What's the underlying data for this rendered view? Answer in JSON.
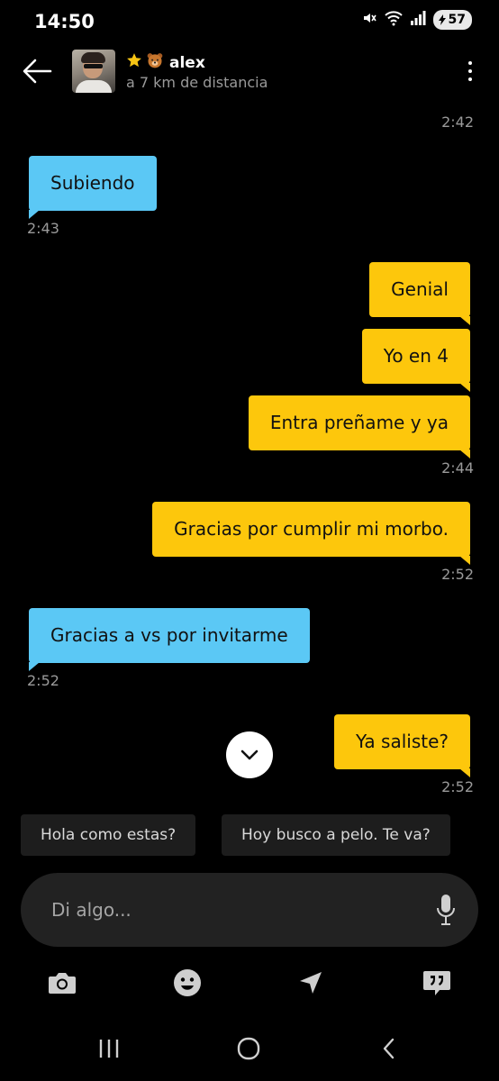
{
  "status_bar": {
    "time": "14:50",
    "battery": "57",
    "icons": [
      "mute-icon",
      "wifi-icon",
      "signal-icon",
      "battery-icon"
    ]
  },
  "header": {
    "badges": [
      "star-icon",
      "bear-icon"
    ],
    "name": "alex",
    "distance": "a 7 km de distancia"
  },
  "messages": [
    {
      "kind": "timestamp",
      "side": "right",
      "text": "2:42"
    },
    {
      "kind": "bubble",
      "direction": "in",
      "text": "Subiendo"
    },
    {
      "kind": "timestamp",
      "side": "left",
      "text": "2:43"
    },
    {
      "kind": "bubble",
      "direction": "out",
      "text": "Genial"
    },
    {
      "kind": "bubble",
      "direction": "out",
      "text": "Yo en 4"
    },
    {
      "kind": "bubble",
      "direction": "out",
      "text": "Entra preñame y ya"
    },
    {
      "kind": "timestamp",
      "side": "right",
      "text": "2:44"
    },
    {
      "kind": "bubble",
      "direction": "out",
      "text": "Gracias por cumplir mi morbo."
    },
    {
      "kind": "timestamp",
      "side": "right",
      "text": "2:52"
    },
    {
      "kind": "bubble",
      "direction": "in",
      "text": "Gracias a vs por invitarme"
    },
    {
      "kind": "timestamp",
      "side": "left",
      "text": "2:52"
    },
    {
      "kind": "bubble",
      "direction": "out",
      "text": "Ya saliste?"
    },
    {
      "kind": "timestamp",
      "side": "right",
      "text": "2:52"
    }
  ],
  "quick_replies": [
    "Hola como estas?",
    "Hoy busco a pelo. Te va?"
  ],
  "compose": {
    "placeholder": "Di algo..."
  },
  "toolbar": [
    "camera-icon",
    "emoji-icon",
    "location-icon",
    "quote-icon"
  ],
  "nav": [
    "recent-apps-icon",
    "home-icon",
    "back-icon"
  ],
  "colors": {
    "incoming_bubble": "#5bc8f5",
    "outgoing_bubble": "#fdc70c",
    "background": "#000000",
    "timestamp": "#9a9a9a"
  }
}
